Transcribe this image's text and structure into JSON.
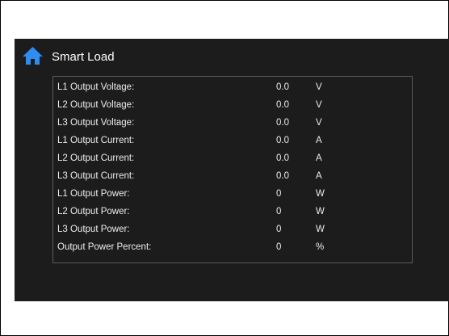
{
  "header": {
    "title": "Smart Load",
    "home_icon": "home-icon"
  },
  "colors": {
    "screen_background": "#1c1c1c",
    "panel_border": "#5a5a5a",
    "home_icon": "#2f8cf0",
    "text": "#ececec"
  },
  "readings": [
    {
      "label": "L1 Output Voltage:",
      "value": "0.0",
      "unit": "V"
    },
    {
      "label": "L2 Output Voltage:",
      "value": "0.0",
      "unit": "V"
    },
    {
      "label": "L3 Output Voltage:",
      "value": "0.0",
      "unit": "V"
    },
    {
      "label": "L1 Output Current:",
      "value": "0.0",
      "unit": "A"
    },
    {
      "label": "L2 Output Current:",
      "value": "0.0",
      "unit": "A"
    },
    {
      "label": "L3 Output Current:",
      "value": "0.0",
      "unit": "A"
    },
    {
      "label": "L1 Output Power:",
      "value": "0",
      "unit": "W"
    },
    {
      "label": "L2 Output Power:",
      "value": "0",
      "unit": "W"
    },
    {
      "label": "L3 Output Power:",
      "value": "0",
      "unit": "W"
    },
    {
      "label": "Output Power Percent:",
      "value": "0",
      "unit": "%"
    }
  ]
}
